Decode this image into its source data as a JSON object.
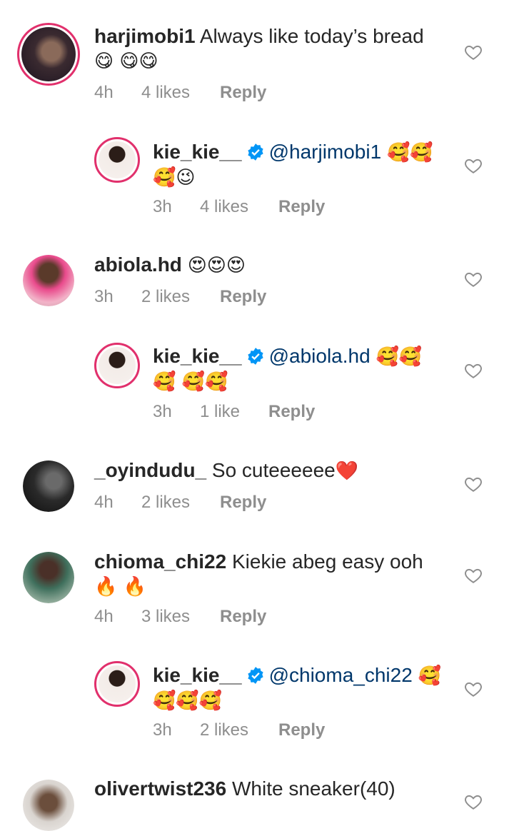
{
  "comments": [
    {
      "user": "harjimobi1",
      "text": "Always like today’s bread",
      "emoji": "😋 😋😋",
      "time": "4h",
      "likes": "4 likes",
      "reply": "Reply"
    },
    {
      "user": "kie_kie__",
      "mention": "@harjimobi1",
      "emoji": "🥰🥰 🥰😉",
      "time": "3h",
      "likes": "4 likes",
      "reply": "Reply"
    },
    {
      "user": "abiola.hd",
      "text": "",
      "emoji": "😍😍😍",
      "time": "3h",
      "likes": "2 likes",
      "reply": "Reply"
    },
    {
      "user": "kie_kie__",
      "mention": "@abiola.hd",
      "emoji": "🥰🥰🥰 🥰🥰",
      "time": "3h",
      "likes": "1 like",
      "reply": "Reply"
    },
    {
      "user": "_oyindudu_",
      "text": "So cuteeeeee",
      "emoji": "❤️",
      "time": "4h",
      "likes": "2 likes",
      "reply": "Reply"
    },
    {
      "user": "chioma_chi22",
      "text": "Kiekie abeg easy ooh",
      "emoji": "🔥 🔥",
      "time": "4h",
      "likes": "3 likes",
      "reply": "Reply"
    },
    {
      "user": "kie_kie__",
      "mention": "@chioma_chi22",
      "emoji": "🥰 🥰🥰🥰",
      "time": "3h",
      "likes": "2 likes",
      "reply": "Reply"
    },
    {
      "user": "olivertwist236",
      "text": "White sneaker(40)"
    }
  ],
  "colors": {
    "text": "#262626",
    "meta": "#8e8e8e",
    "verified": "#0095f6",
    "ring": "#e1306c"
  }
}
